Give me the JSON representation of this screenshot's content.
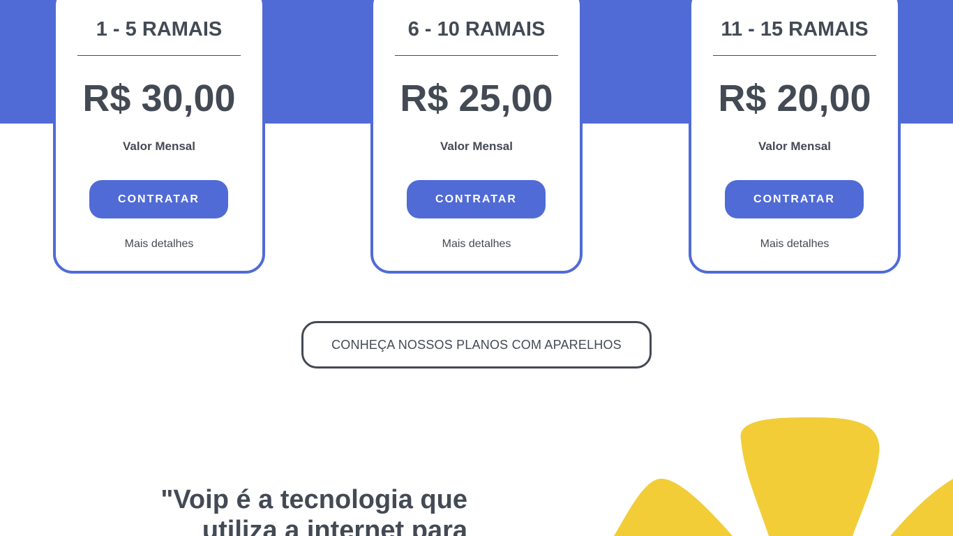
{
  "colors": {
    "accent": "#506bd6",
    "text": "#434a54",
    "yellow": "#f2cd38",
    "background": "#ffffff"
  },
  "cards": [
    {
      "title": "1 - 5 RAMAIS",
      "price": "R$ 30,00",
      "subtitle": "Valor Mensal",
      "button_label": "CONTRATAR",
      "link_label": "Mais detalhes"
    },
    {
      "title": "6 - 10 RAMAIS",
      "price": "R$ 25,00",
      "subtitle": "Valor Mensal",
      "button_label": "CONTRATAR",
      "link_label": "Mais detalhes"
    },
    {
      "title": "11 - 15 RAMAIS",
      "price": "R$ 20,00",
      "subtitle": "Valor Mensal",
      "button_label": "CONTRATAR",
      "link_label": "Mais detalhes"
    }
  ],
  "plans_button_label": "CONHEÇA NOSSOS PLANOS COM APARELHOS",
  "quote": {
    "line1": "\"Voip é a tecnologia que",
    "line2": "utiliza a internet para"
  },
  "decoration_icon": "yellow-flower-petals"
}
